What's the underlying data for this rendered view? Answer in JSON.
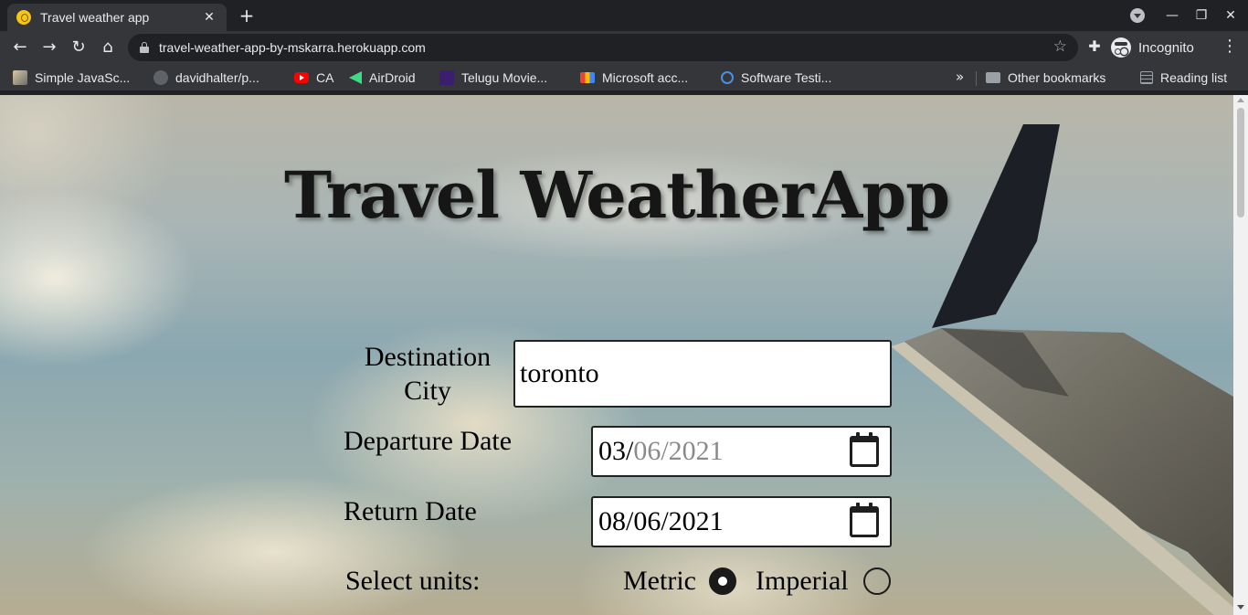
{
  "browser": {
    "tab_title": "Travel weather app",
    "url": "travel-weather-app-by-mskarra.herokuapp.com",
    "profile_label": "Incognito",
    "bookmarks": [
      {
        "label": "Simple JavaSc...",
        "icon": "js-book-icon"
      },
      {
        "label": "davidhalter/p...",
        "icon": "github-icon"
      },
      {
        "label": "CA",
        "icon": "youtube-icon"
      },
      {
        "label": "AirDroid",
        "icon": "airdroid-icon"
      },
      {
        "label": "Telugu Movie...",
        "icon": "telugu-movie-icon"
      },
      {
        "label": "Microsoft acc...",
        "icon": "gmail-icon"
      },
      {
        "label": "Software Testi...",
        "icon": "software-testing-icon"
      }
    ],
    "other_bookmarks": "Other bookmarks",
    "reading_list": "Reading list"
  },
  "app": {
    "title": "Travel WeatherApp",
    "destination_label_line1": "Destination",
    "destination_label_line2": "City",
    "destination_value": "toronto",
    "departure_label": "Departure Date",
    "departure_value": {
      "day": "03/",
      "month_year": "06/2021"
    },
    "return_label": "Return Date",
    "return_value": "08/06/2021",
    "units_label": "Select units:",
    "units_options": [
      {
        "label": "Metric",
        "selected": true
      },
      {
        "label": "Imperial",
        "selected": false
      }
    ]
  }
}
